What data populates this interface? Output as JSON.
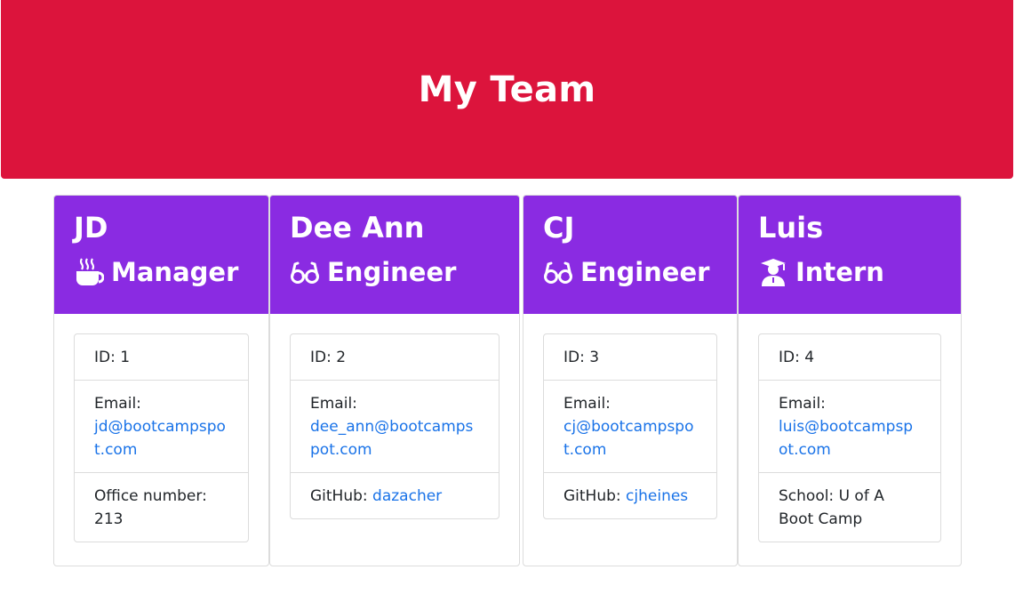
{
  "header": {
    "title": "My Team"
  },
  "cards": [
    {
      "name": "JD",
      "role": "Manager",
      "role_icon": "coffee-icon",
      "id_text": "ID: 1",
      "email_label": "Email:",
      "email": "jd@bootcampspot.com",
      "extra_label": "Office number: ",
      "extra_value": "213"
    },
    {
      "name": "Dee Ann",
      "role": "Engineer",
      "role_icon": "glasses-icon",
      "id_text": "ID: 2",
      "email_label": "Email:",
      "email": "dee_ann@bootcampspot.com",
      "extra_label": "GitHub: ",
      "extra_value": "dazacher"
    },
    {
      "name": "CJ",
      "role": "Engineer",
      "role_icon": "glasses-icon",
      "id_text": "ID: 3",
      "email_label": "Email:",
      "email": "cj@bootcampspot.com",
      "extra_label": "GitHub: ",
      "extra_value": "cjheines"
    },
    {
      "name": "Luis",
      "role": "Intern",
      "role_icon": "graduate-icon",
      "id_text": "ID: 4",
      "email_label": "Email:",
      "email": "luis@bootcampspot.com",
      "extra_label": "School: ",
      "extra_value": "U of A Boot Camp"
    }
  ],
  "colors": {
    "header_bg": "#dc143c",
    "card_head_bg": "#8a2be2",
    "link": "#1a73e8"
  }
}
